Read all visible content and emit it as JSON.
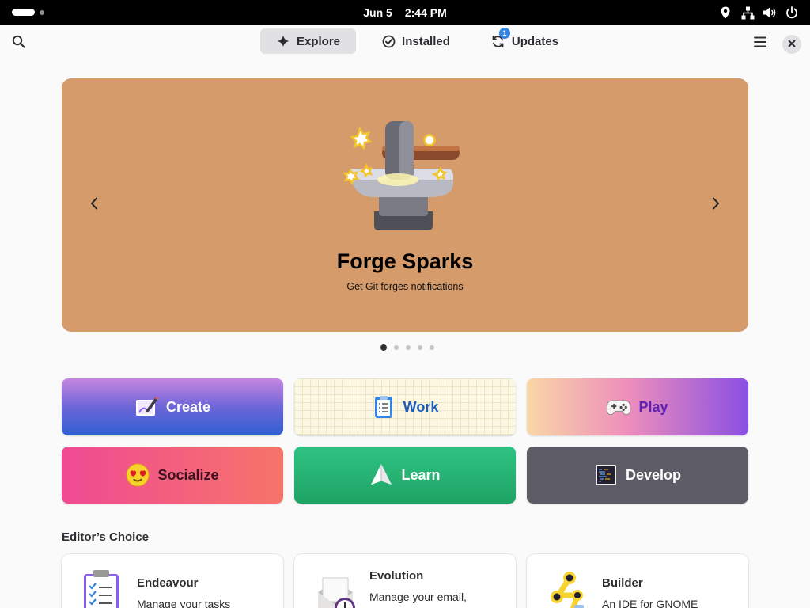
{
  "topbar": {
    "date": "Jun 5",
    "time": "2:44 PM",
    "tray_icons": [
      "location-icon",
      "network-icon",
      "volume-icon",
      "power-icon"
    ]
  },
  "header": {
    "tabs": [
      {
        "label": "Explore",
        "icon": "sparkle-icon",
        "active": true
      },
      {
        "label": "Installed",
        "icon": "checkmark-circle-icon",
        "active": false
      },
      {
        "label": "Updates",
        "icon": "refresh-icon",
        "active": false,
        "badge": "1"
      }
    ],
    "buttons": [
      "search-icon",
      "hamburger-menu-icon",
      "close-icon"
    ]
  },
  "featured": {
    "title": "Forge Sparks",
    "subtitle": "Get Git forges notifications",
    "background": "#d59b6b",
    "page_count": 5,
    "active_page": 1
  },
  "categories": [
    {
      "label": "Create",
      "icon": "create-icon"
    },
    {
      "label": "Work",
      "icon": "clipboard-icon"
    },
    {
      "label": "Play",
      "icon": "gamepad-icon"
    },
    {
      "label": "Socialize",
      "icon": "emoji-heart-eyes-icon"
    },
    {
      "label": "Learn",
      "icon": "paper-plane-icon"
    },
    {
      "label": "Develop",
      "icon": "terminal-icon"
    }
  ],
  "editors_choice": {
    "title": "Editor’s Choice",
    "apps": [
      {
        "name": "Endeavour",
        "description": "Manage your tasks",
        "icon": "endeavour-icon"
      },
      {
        "name": "Evolution",
        "description": "Manage your email, contacts and schedule",
        "icon": "evolution-icon"
      },
      {
        "name": "Builder",
        "description": "An IDE for GNOME",
        "icon": "builder-icon"
      }
    ]
  },
  "colors": {
    "accent": "#3584e4",
    "active_tab_bg": "#e1e1e3",
    "window_bg": "#fafafb"
  }
}
